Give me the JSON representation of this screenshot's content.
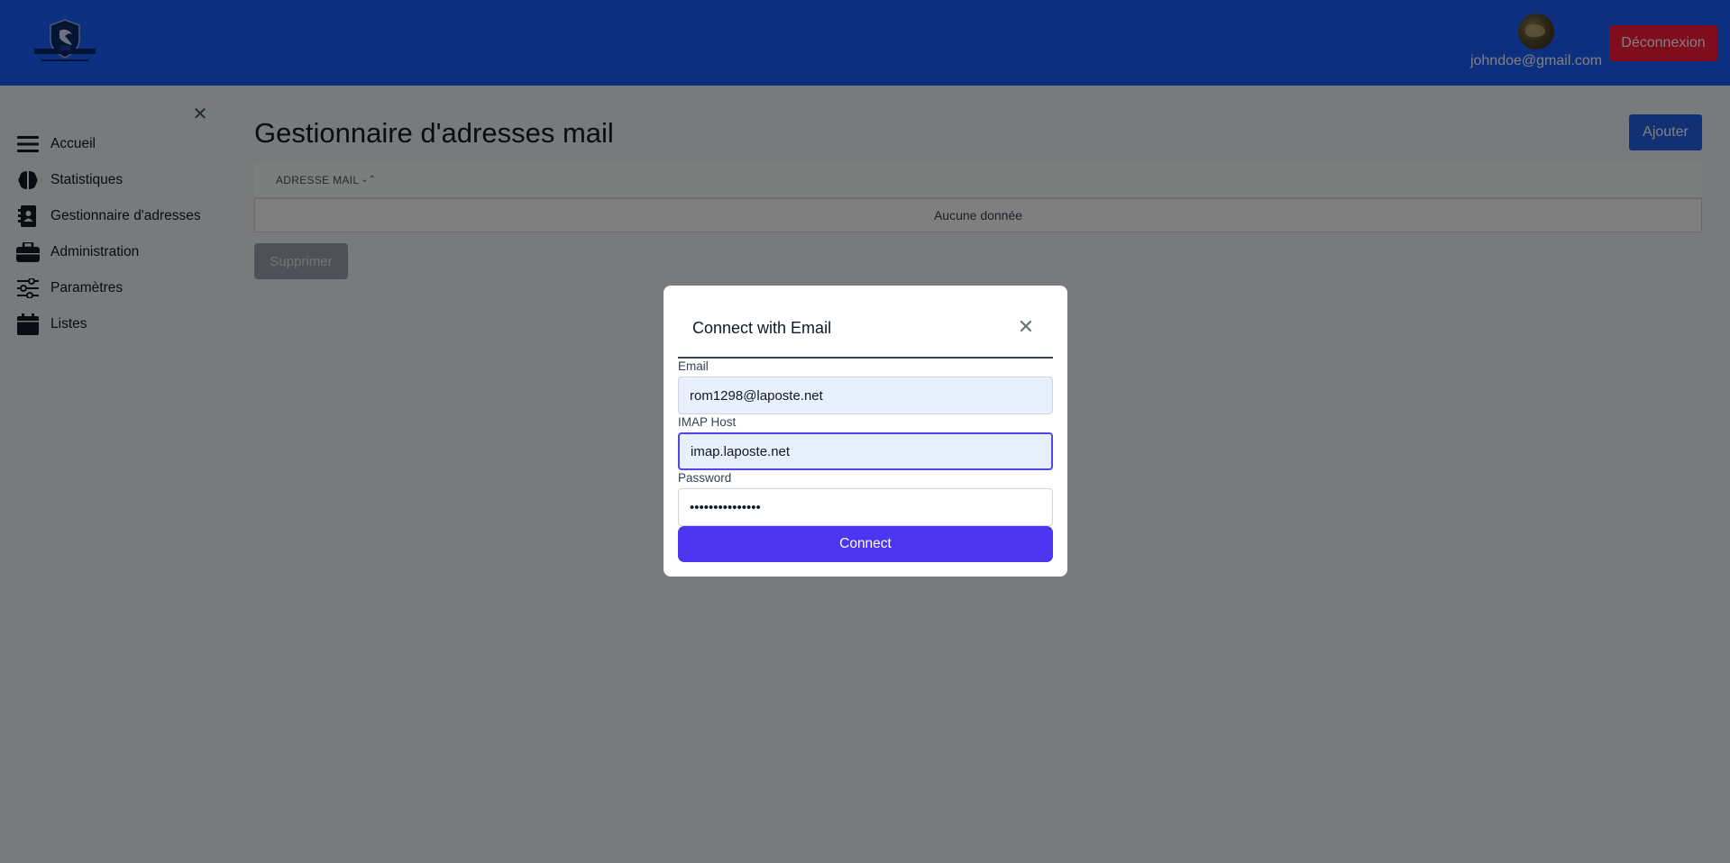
{
  "header": {
    "logo_icon": "shield-logo",
    "user_email": "johndoe@gmail.com",
    "logout_label": "Déconnexion",
    "avatar_icon": "user-avatar"
  },
  "sidebar": {
    "close_icon": "close-icon",
    "items": [
      {
        "label": "Accueil",
        "icon": "menu-icon"
      },
      {
        "label": "Statistiques",
        "icon": "brain-icon"
      },
      {
        "label": "Gestionnaire d'adresses",
        "icon": "address-book-icon"
      },
      {
        "label": "Administration",
        "icon": "briefcase-icon"
      },
      {
        "label": "Paramètres",
        "icon": "sliders-icon"
      },
      {
        "label": "Listes",
        "icon": "calendar-icon"
      }
    ]
  },
  "main": {
    "title": "Gestionnaire d'adresses mail",
    "add_label": "Ajouter",
    "table": {
      "column_header": "ADRESSE MAIL",
      "empty_text": "Aucune donnée"
    },
    "delete_label": "Supprimer"
  },
  "modal": {
    "title": "Connect with Email",
    "email_label": "Email",
    "email_value": "rom1298@laposte.net",
    "imap_label": "IMAP Host",
    "imap_value": "imap.laposte.net",
    "password_label": "Password",
    "password_value": "•••••••••••••••",
    "connect_label": "Connect"
  },
  "colors": {
    "header_bg": "#1a5fff",
    "logout_bg": "#ff1a3c",
    "connect_bg": "#4c35f0",
    "add_bg": "#2563eb"
  }
}
